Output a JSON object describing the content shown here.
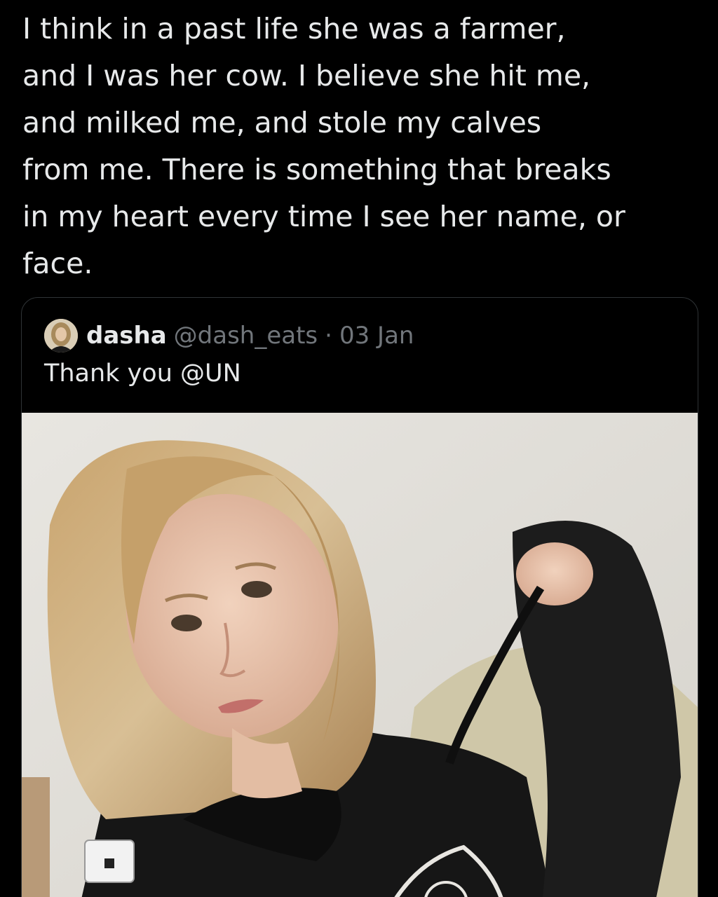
{
  "tweet": {
    "text": "I think in a past life she was a farmer,\nand I was her cow. I believe she hit me,\nand milked me, and stole my calves\nfrom me. There is something that breaks\nin my heart every time I see her name, or\nface."
  },
  "quoted_tweet": {
    "author_name": "dasha",
    "author_handle": "@dash_eats",
    "separator": "·",
    "date": "03 Jan",
    "text": "Thank you @UN",
    "avatar_icon": "profile-photo-avatar",
    "media": "photo"
  },
  "colors": {
    "background": "#000000",
    "primary_text": "#e7e9ea",
    "secondary_text": "#71767b",
    "card_border": "#2f3336"
  }
}
